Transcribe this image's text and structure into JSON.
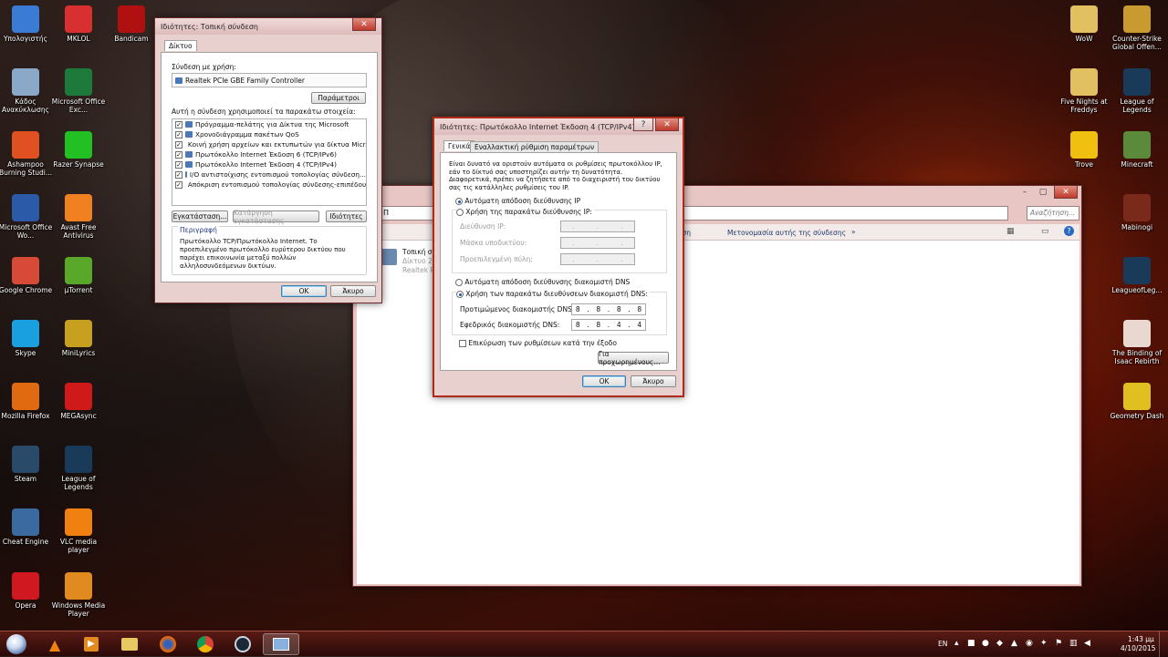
{
  "desktop_left": [
    {
      "label": "Υπολογιστής",
      "icon": "computer-icon",
      "color": "#3a7bd5"
    },
    {
      "label": "MKLOL",
      "icon": "mklol-icon",
      "color": "#d83030"
    },
    {
      "label": "Bandicam",
      "icon": "bandicam-icon",
      "color": "#b01010"
    },
    {
      "label": "Κάδος Ανακύκλωσης",
      "icon": "recycle-bin-icon",
      "color": "#8aa8c8"
    },
    {
      "label": "Microsoft Office Exc...",
      "icon": "excel-icon",
      "color": "#1e7a3a"
    },
    {
      "label": "Ashampoo Burning Studi...",
      "icon": "ashampoo-icon",
      "color": "#e05020"
    },
    {
      "label": "Razer Synapse",
      "icon": "razer-icon",
      "color": "#22c022"
    },
    {
      "label": "Microsoft Office Wo...",
      "icon": "word-icon",
      "color": "#2a5aa8"
    },
    {
      "label": "Avast Free Antivirus",
      "icon": "avast-icon",
      "color": "#f08020"
    },
    {
      "label": "Google Chrome",
      "icon": "chrome-icon",
      "color": "#d84a38"
    },
    {
      "label": "µTorrent",
      "icon": "utorrent-icon",
      "color": "#5aa82a"
    },
    {
      "label": "Skype",
      "icon": "skype-icon",
      "color": "#1aa0e0"
    },
    {
      "label": "MiniLyrics",
      "icon": "minilyrics-icon",
      "color": "#c8a020"
    },
    {
      "label": "Mozilla Firefox",
      "icon": "firefox-icon",
      "color": "#e06a10"
    },
    {
      "label": "MEGAsync",
      "icon": "mega-icon",
      "color": "#d01a1a"
    },
    {
      "label": "Steam",
      "icon": "steam-icon",
      "color": "#2a4a6a"
    },
    {
      "label": "League of Legends",
      "icon": "lol-icon",
      "color": "#1a3a5a"
    },
    {
      "label": "Cheat Engine",
      "icon": "cheat-engine-icon",
      "color": "#3a6aa0"
    },
    {
      "label": "VLC media player",
      "icon": "vlc-icon",
      "color": "#f08010"
    },
    {
      "label": "Opera",
      "icon": "opera-icon",
      "color": "#d01820"
    },
    {
      "label": "Windows Media Player",
      "icon": "wmp-icon",
      "color": "#e08a20"
    }
  ],
  "desktop_right": [
    {
      "label": "WoW",
      "icon": "folder-icon",
      "color": "#e0c060"
    },
    {
      "label": "Counter-Strike Global Offen...",
      "icon": "csgo-icon",
      "color": "#c89a30"
    },
    {
      "label": "Five Nights at Freddys",
      "icon": "folder-icon",
      "color": "#e0c060"
    },
    {
      "label": "League of Legends",
      "icon": "lol-icon",
      "color": "#1a3a5a"
    },
    {
      "label": "Trove",
      "icon": "trove-icon",
      "color": "#f0c010"
    },
    {
      "label": "Minecraft",
      "icon": "minecraft-icon",
      "color": "#5a8a3a"
    },
    {
      "label": "Mabinogi",
      "icon": "mabinogi-icon",
      "color": "#7a2a1a"
    },
    {
      "label": "LeagueofLeg...",
      "icon": "lol-icon",
      "color": "#1a3a5a"
    },
    {
      "label": "The Binding of Isaac Rebirth",
      "icon": "isaac-icon",
      "color": "#e8d8d0"
    },
    {
      "label": "Geometry Dash",
      "icon": "geometry-dash-icon",
      "color": "#e0c020"
    }
  ],
  "lan_dialog": {
    "title": "Ιδιότητες: Τοπική σύνδεση",
    "tab": "Δίκτυο",
    "connect_using_label": "Σύνδεση με χρήση:",
    "adapter": "Realtek PCIe GBE Family Controller",
    "configure_button": "Παράμετροι",
    "items_label": "Αυτή η σύνδεση χρησιμοποιεί τα παρακάτω στοιχεία:",
    "items": [
      "Πρόγραμμα-πελάτης για Δίκτυα της Microsoft",
      "Χρονοδιάγραμμα πακέτων QoS",
      "Κοινή χρήση αρχείων και εκτυπωτών για δίκτυα Micr...",
      "Πρωτόκολλο Internet Έκδοση 6 (TCP/IPv6)",
      "Πρωτόκολλο Internet Έκδοση 4 (TCP/IPv4)",
      "I/O αντιστοίχισης εντοπισμού τοπολογίας σύνδεση...",
      "Απόκριση εντοπισμού τοπολογίας σύνδεσης-επιπέδου"
    ],
    "install_button": "Εγκατάσταση...",
    "uninstall_button": "Κατάργηση εγκατάστασης",
    "properties_button": "Ιδιότητες",
    "description_label": "Περιγραφή",
    "description": "Πρωτόκολλο TCP/Πρωτόκολλο Internet. Το προεπιλεγμένο πρωτόκολλο ευρύτερου δικτύου που παρέχει επικοινωνία μεταξύ πολλών αλληλοσυνδεόμενων δικτύων.",
    "ok_button": "OK",
    "cancel_button": "Άκυρο"
  },
  "ipv4_dialog": {
    "title": "Ιδιότητες: Πρωτόκολλο Internet Έκδοση 4 (TCP/IPv4)",
    "tab_general": "Γενικά",
    "tab_alternate": "Εναλλακτική ρύθμιση παραμέτρων",
    "intro": "Είναι δυνατό να οριστούν αυτόματα οι ρυθμίσεις πρωτοκόλλου IP, εάν το δίκτυό σας υποστηρίζει αυτήν τη δυνατότητα. Διαφορετικά, πρέπει να ζητήσετε από το διαχειριστή του δικτύου σας τις κατάλληλες ρυθμίσεις του IP.",
    "auto_ip": "Αυτόματη απόδοση διεύθυνσης IP",
    "manual_ip": "Χρήση της παρακάτω διεύθυνσης IP:",
    "ip_label": "Διεύθυνση IP:",
    "mask_label": "Μάσκα υποδικτύου:",
    "gateway_label": "Προεπιλεγμένη πύλη:",
    "auto_dns": "Αυτόματη απόδοση διεύθυνσης διακομιστή DNS",
    "manual_dns": "Χρήση των παρακάτω διευθύνσεων διακομιστή DNS:",
    "preferred_dns_label": "Προτιμώμενος διακομιστής DNS:",
    "alternate_dns_label": "Εφεδρικός διακομιστής DNS:",
    "preferred_dns": [
      "8",
      "8",
      "8",
      "8"
    ],
    "alternate_dns": [
      "8",
      "8",
      "4",
      "4"
    ],
    "validate_label": "Επικύρωση των ρυθμίσεων κατά την έξοδο",
    "advanced_button": "Για προχωρημένους...",
    "ok_button": "OK",
    "cancel_button": "Άκυρο"
  },
  "explorer": {
    "address": "Π",
    "search_placeholder": "Αναζήτηση...",
    "toolbar_partial": "νωση",
    "rename_link": "Μετονομασία αυτής της σύνδεσης",
    "more": "»",
    "conn_name": "Τοπική σ",
    "conn_status": "Δίκτυο 2",
    "conn_adapter": "Realtek PC"
  },
  "taskbar": {
    "language": "EN",
    "time": "1:43 μμ",
    "date": "4/10/2015"
  }
}
